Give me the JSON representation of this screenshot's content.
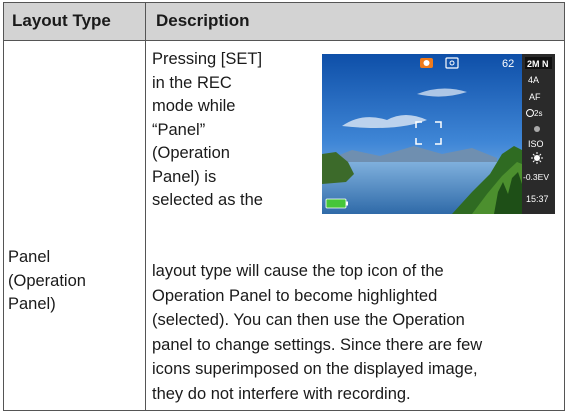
{
  "header": {
    "layout_type": "Layout Type",
    "description": "Description"
  },
  "row": {
    "layout_type_lines": [
      "Panel",
      "(Operation",
      "Panel)"
    ],
    "description_narrow_lines": [
      "Pressing [SET]",
      "in the REC",
      "mode while",
      "“Panel”",
      "(Operation",
      "Panel) is",
      "selected as the"
    ],
    "description_wide_lines": [
      "layout type will cause the top icon of the",
      "Operation Panel to become highlighted",
      "(selected). You can then use the Operation",
      "panel to change settings. Since there are few",
      "icons superimposed on the displayed image,",
      "they do not interfere with recording."
    ]
  },
  "screen": {
    "shot_count": "62",
    "panel_items": [
      "2M N",
      "4A",
      "AF",
      "2s",
      "",
      "ISO",
      "",
      "-0.3EV",
      "15:37"
    ],
    "icons": [
      "camera-mode-icon",
      "memory-card-icon",
      "focus-frame-icon",
      "battery-icon",
      "flash-icon",
      "self-timer-icon",
      "face-detection-icon",
      "white-balance-icon"
    ],
    "colors": {
      "panel_bg": "#2a2a2a",
      "camera_icon": "#f07a1a",
      "battery": "#46c63a",
      "sky_top": "#0e4fa8"
    }
  }
}
